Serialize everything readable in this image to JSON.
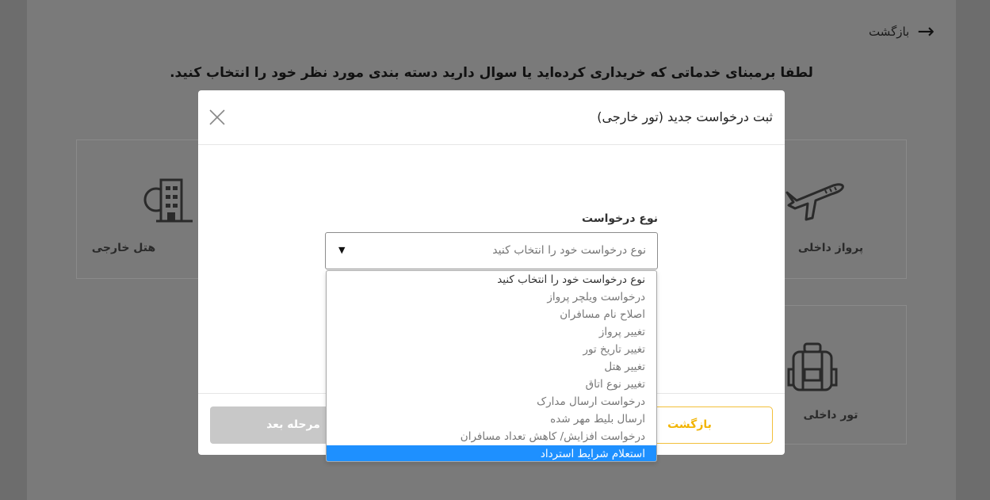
{
  "page": {
    "back_label": "بازگشت",
    "heading": "لطفا برمبنای خدماتی که خریداری کرده‌اید یا سوال دارید دسته بندی مورد نظر خود را انتخاب کنید."
  },
  "cards": {
    "foreign_hotel": "هتل خارجی",
    "domestic_flight": "پرواز داخلی",
    "domestic_tour": "تور داخلی"
  },
  "modal": {
    "title": "ثبت درخواست جدید (تور خارجی)",
    "field_label": "نوع درخواست",
    "select_placeholder": "نوع درخواست خود را انتخاب کنید",
    "next_button": "مرحله بعد",
    "back_button": "بازگشت"
  },
  "dropdown": {
    "options": [
      "نوع درخواست خود را انتخاب کنید",
      "درخواست ویلچر پرواز",
      "اصلاح نام مسافران",
      "تغییر پرواز",
      "تغییر تاریخ تور",
      "تغییر هتل",
      "تغییر نوع اتاق",
      "درخواست ارسال مدارک",
      "ارسال بلیط مهر شده",
      "درخواست افزایش/ کاهش تعداد مسافران",
      "استعلام شرایط استرداد"
    ],
    "selected_index": 10
  },
  "colors": {
    "accent": "#f2b400",
    "highlight": "#1e90ff"
  }
}
